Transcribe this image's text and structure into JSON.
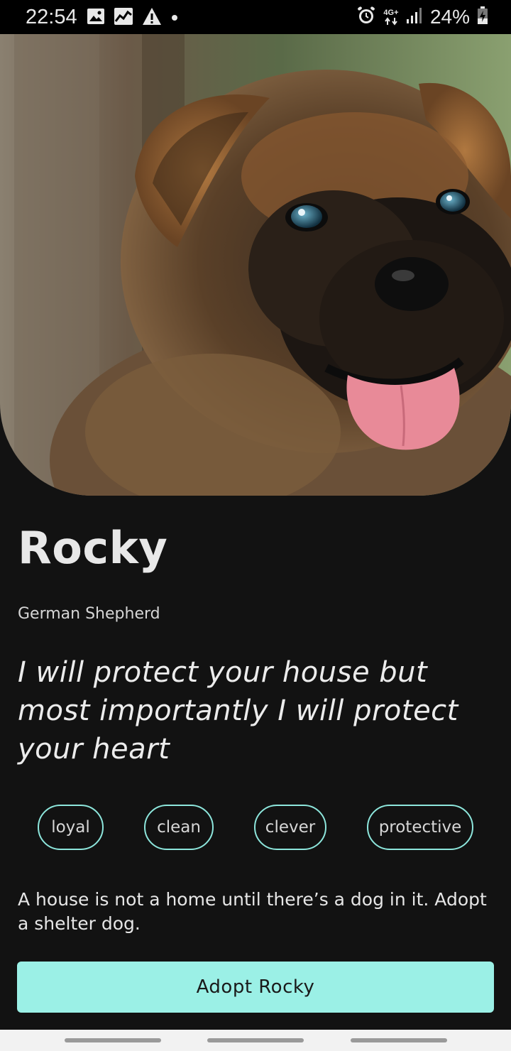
{
  "status_bar": {
    "time": "22:54",
    "network": "4G+",
    "battery_percent": "24%",
    "icons": [
      "image-icon",
      "chart-icon",
      "warning-icon",
      "dot-icon",
      "alarm-icon",
      "network-arrows-icon",
      "signal-icon",
      "battery-charging-icon"
    ]
  },
  "hero": {
    "image": "german-shepherd-puppy-photo"
  },
  "pet": {
    "name": "Rocky",
    "breed": "German Shepherd",
    "tagline": "I will protect your house but most importantly I will protect your heart",
    "traits": [
      "loyal",
      "clean",
      "clever",
      "protective"
    ],
    "quote": "A house is not a home until there’s a dog in it. Adopt a shelter dog."
  },
  "actions": {
    "adopt_label": "Adopt Rocky"
  },
  "colors": {
    "background": "#121212",
    "accent": "#9bf0e6",
    "chip_border": "#8de6dc"
  }
}
